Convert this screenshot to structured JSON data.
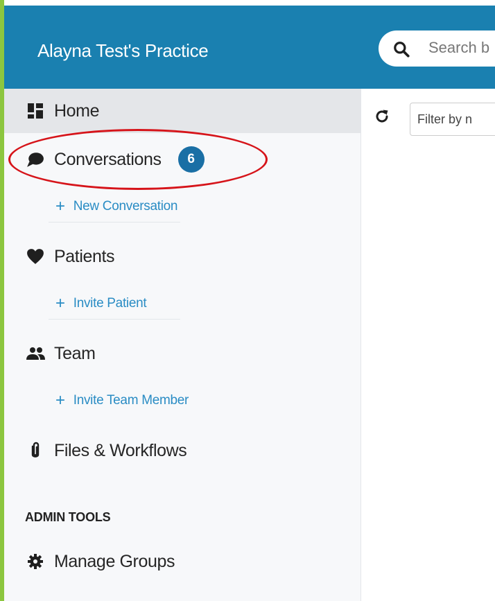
{
  "header": {
    "practice_name": "Alayna Test's Practice",
    "search_placeholder": "Search b"
  },
  "sidebar": {
    "items": [
      {
        "label": "Home",
        "icon": "dashboard-icon",
        "active": true
      },
      {
        "label": "Conversations",
        "icon": "chat-bubble-icon",
        "badge": "6"
      },
      {
        "label": "Patients",
        "icon": "heart-icon"
      },
      {
        "label": "Team",
        "icon": "people-icon"
      },
      {
        "label": "Files & Workflows",
        "icon": "paperclip-icon"
      }
    ],
    "sub_actions": {
      "new_conversation": "New Conversation",
      "invite_patient": "Invite Patient",
      "invite_team_member": "Invite Team Member"
    },
    "admin_tools_header": "ADMIN TOOLS",
    "manage_groups": "Manage Groups"
  },
  "content": {
    "filter_placeholder": "Filter by n"
  },
  "colors": {
    "header_bg": "#1a80b0",
    "accent_green": "#8cc63f",
    "badge_bg": "#1a6fa5",
    "link_blue": "#2a8cc4",
    "highlight_red": "#d6141a"
  }
}
